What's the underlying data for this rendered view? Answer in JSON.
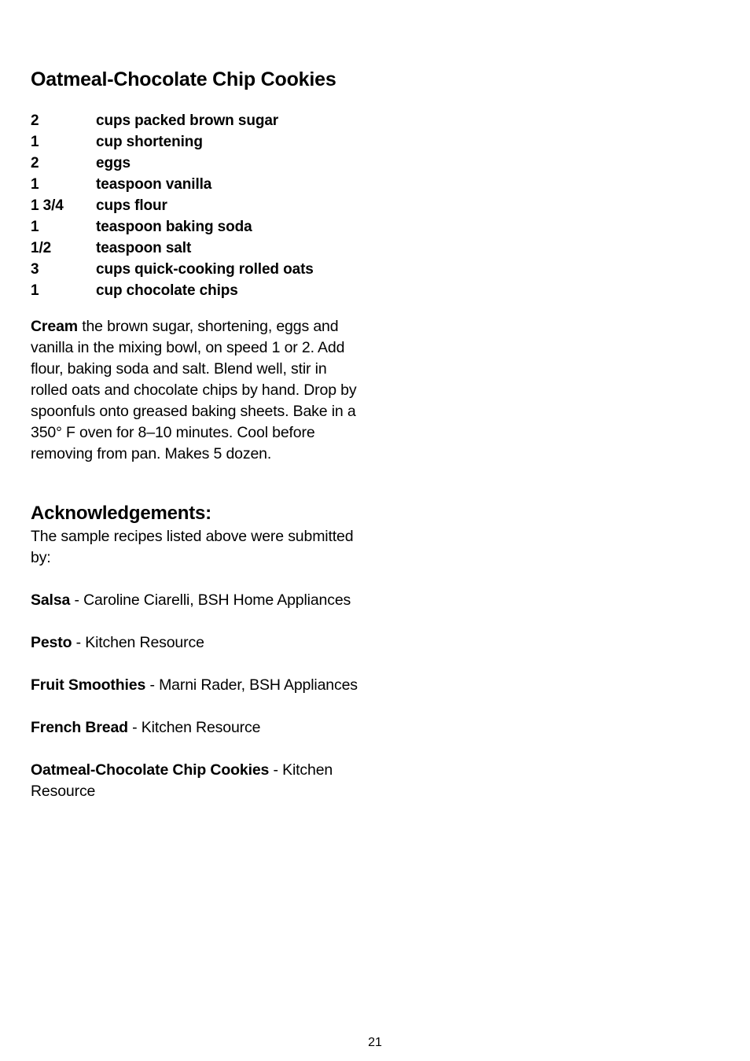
{
  "recipe": {
    "title": "Oatmeal-Chocolate Chip Cookies",
    "ingredients": [
      {
        "quantity": "2",
        "item": "cups packed brown sugar"
      },
      {
        "quantity": "1",
        "item": "cup shortening"
      },
      {
        "quantity": "2",
        "item": "eggs"
      },
      {
        "quantity": "1",
        "item": "teaspoon vanilla"
      },
      {
        "quantity": "1 3/4",
        "item": "cups flour"
      },
      {
        "quantity": "1",
        "item": "teaspoon baking soda"
      },
      {
        "quantity": "1/2",
        "item": "teaspoon salt"
      },
      {
        "quantity": "3",
        "item": "cups quick-cooking rolled oats"
      },
      {
        "quantity": "1",
        "item": "cup chocolate chips"
      }
    ],
    "instructions_lead": "Cream",
    "instructions_body": " the brown sugar, shortening, eggs and vanilla in the mixing bowl, on speed 1 or 2. Add flour, baking soda and salt. Blend well, stir in rolled oats and chocolate chips by hand. Drop by spoonfuls onto greased baking sheets. Bake in a 350° F oven for 8–10 minutes. Cool before removing from pan. Makes 5 dozen."
  },
  "acknowledgements": {
    "heading": "Acknowledgements:",
    "intro": "The sample recipes listed above were submitted by:",
    "separator": " - ",
    "credits": [
      {
        "recipe": "Salsa",
        "source": "Caroline Ciarelli, BSH Home Appliances"
      },
      {
        "recipe": "Pesto",
        "source": "Kitchen Resource"
      },
      {
        "recipe": "Fruit Smoothies",
        "source": "Marni Rader, BSH Appliances"
      },
      {
        "recipe": "French Bread",
        "source": "Kitchen Resource"
      },
      {
        "recipe": "Oatmeal-Chocolate Chip Cookies",
        "source": "Kitchen Resource"
      }
    ]
  },
  "footer": {
    "page_number": "21"
  }
}
